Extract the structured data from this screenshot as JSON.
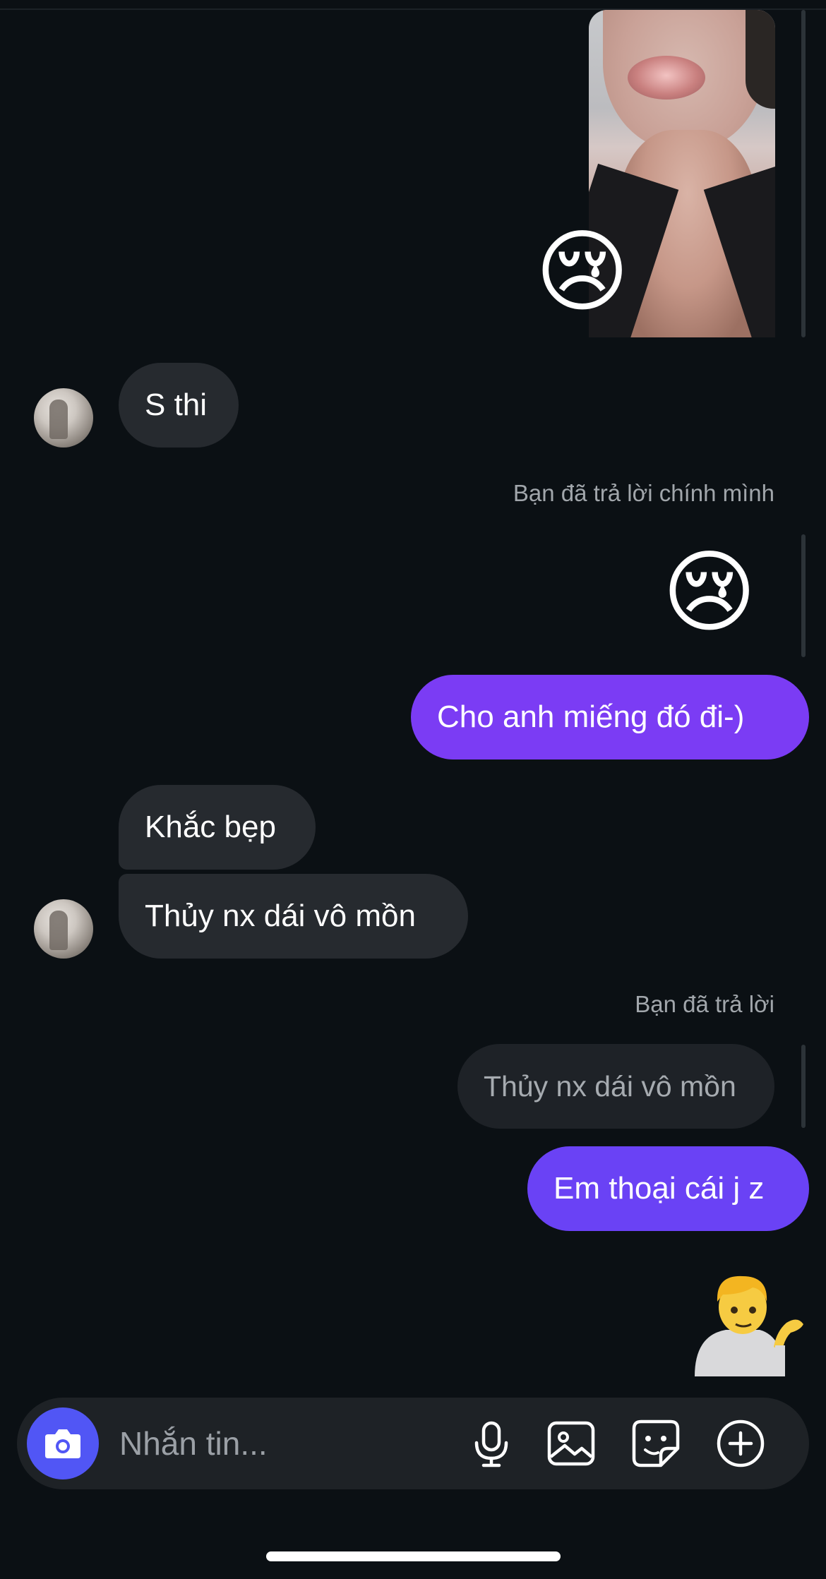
{
  "thread": {
    "photo_reaction_emoji": "😢",
    "message_1": "S thi",
    "reply_meta_1": "Bạn đã trả lời chính mình",
    "reply_emoji_quote": "😢",
    "message_2": "Cho anh miếng đó đi-)",
    "message_3": "Khắc bẹp",
    "message_4": "Thủy nx dái vô mồn",
    "reply_meta_2": "Bạn đã trả lời",
    "reply_quote_2": "Thủy nx dái vô mồn",
    "message_5": "Em thoại cái j z"
  },
  "composer": {
    "placeholder": "Nhắn tin...",
    "icons": [
      "camera-icon",
      "microphone-icon",
      "gallery-icon",
      "sticker-icon",
      "plus-icon"
    ]
  },
  "colors": {
    "background": "#0b1014",
    "incoming_bubble": "#262a2f",
    "outgoing_purple": "#7b3cf4",
    "outgoing_violet": "#6a42f5",
    "camera_button": "#5156f5"
  }
}
